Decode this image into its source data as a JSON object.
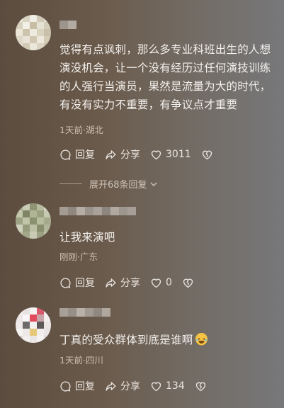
{
  "comments": [
    {
      "text": "觉得有点讽刺，那么多专业科班出生的人想演没机会，让一个没有经历过任何演技训练的人强行当演员，果然是流量为大的时代，有没有实力不重要，有争议点才重要",
      "meta": "1天前·湖北",
      "reply_label": "回复",
      "share_label": "分享",
      "like_count": "3011"
    },
    {
      "text": "让我来演吧",
      "meta": "刚刚·广东",
      "reply_label": "回复",
      "share_label": "分享",
      "like_count": "0"
    },
    {
      "text": "丁真的受众群体到底是谁啊",
      "meta": "1天前·四川",
      "reply_label": "回复",
      "share_label": "分享",
      "like_count": "134"
    }
  ],
  "expand_replies": "展开68条回复",
  "icons": {
    "reply": "comment-bubble-icon",
    "share": "share-arrow-icon",
    "like": "heart-icon",
    "dislike": "broken-heart-icon",
    "expand": "chevron-down-icon",
    "emoji": "laughing-tears-emoji"
  },
  "colors": {
    "text": "#f4f1ee",
    "meta": "#cbbfb2",
    "action": "#e9e4df"
  }
}
